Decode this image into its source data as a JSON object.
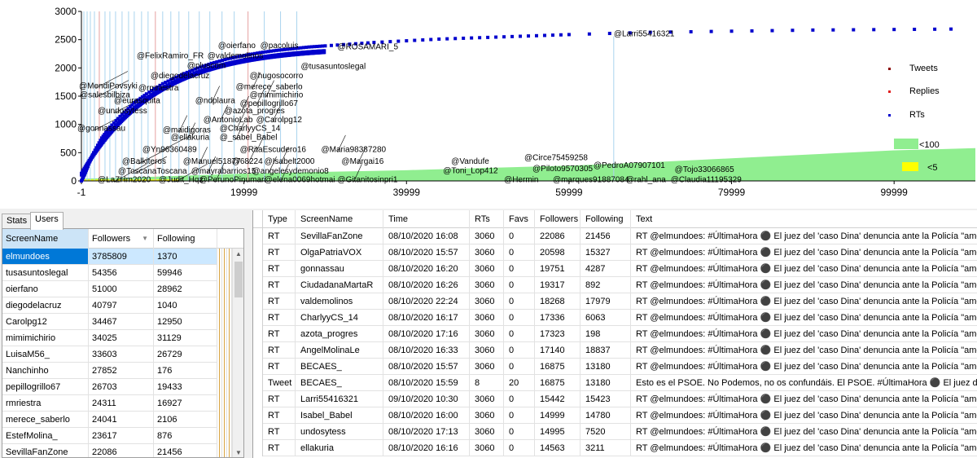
{
  "chart_data": {
    "type": "scatter",
    "title": "",
    "xlabel": "",
    "ylabel": "",
    "xlim": [
      -1,
      109999
    ],
    "ylim": [
      0,
      3000
    ],
    "x_ticks": [
      "-1",
      "19999",
      "39999",
      "59999",
      "79999",
      "99999"
    ],
    "y_ticks": [
      "0",
      "500",
      "1000",
      "1500",
      "2000",
      "2500",
      "3000"
    ],
    "legend_position": "right",
    "legend": [
      {
        "label": "Tweets",
        "color": "#8b0000"
      },
      {
        "label": "Replies",
        "color": "#e02020"
      },
      {
        "label": "RTs",
        "color": "#0000cd"
      },
      {
        "label": "<100",
        "color": "#90ee90"
      },
      {
        "label": "<5",
        "color": "#ffff00"
      }
    ],
    "series": [
      {
        "name": "RTs",
        "color": "#0000cd",
        "x": [
          0,
          400,
          800,
          1500,
          2500,
          3500,
          5000,
          6500,
          8000,
          10000,
          12000,
          14000,
          16000,
          18000,
          20000,
          22000,
          24000,
          26000,
          28000,
          30000,
          33000,
          36000,
          40000,
          44000,
          48000,
          52000,
          56000,
          60000,
          65000,
          70000,
          75000,
          80000,
          85000,
          90000,
          95000,
          100000,
          105000,
          109000
        ],
        "y": [
          0,
          120,
          260,
          500,
          760,
          950,
          1180,
          1380,
          1540,
          1720,
          1860,
          1980,
          2080,
          2160,
          2220,
          2270,
          2310,
          2340,
          2370,
          2390,
          2420,
          2450,
          2480,
          2510,
          2530,
          2550,
          2570,
          2590,
          2610,
          2630,
          2640,
          2650,
          2660,
          2670,
          2675,
          2680,
          2685,
          2690
        ]
      }
    ],
    "annotations": [
      {
        "text": "@Larri55416321",
        "x": 65500,
        "y": 2560
      },
      {
        "text": "@oierfano",
        "x": 16800,
        "y": 2350
      },
      {
        "text": "@pacoluis",
        "x": 22000,
        "y": 2350
      },
      {
        "text": "@ROSAMARI_5",
        "x": 31500,
        "y": 2330
      },
      {
        "text": "@FelixRamiro_FR",
        "x": 6800,
        "y": 2170
      },
      {
        "text": "@valdemolinos",
        "x": 15500,
        "y": 2170
      },
      {
        "text": "@pluscom",
        "x": 13000,
        "y": 2000
      },
      {
        "text": "@tusasuntoslegal",
        "x": 27000,
        "y": 1980
      },
      {
        "text": "@diegodelacruz",
        "x": 8500,
        "y": 1820
      },
      {
        "text": "@hugosocorro",
        "x": 20700,
        "y": 1820
      },
      {
        "text": "@MendiPovsyki",
        "x": -300,
        "y": 1640
      },
      {
        "text": "@rmriestra",
        "x": 7000,
        "y": 1600
      },
      {
        "text": "@merece_saberlo",
        "x": 19000,
        "y": 1620
      },
      {
        "text": "@salesbilbiza",
        "x": -200,
        "y": 1480
      },
      {
        "text": "@mimimichirio",
        "x": 20700,
        "y": 1480
      },
      {
        "text": "@eurasquita",
        "x": 4000,
        "y": 1380
      },
      {
        "text": "@ndplaura",
        "x": 14000,
        "y": 1380
      },
      {
        "text": "@pepillogrillo67",
        "x": 19500,
        "y": 1330
      },
      {
        "text": "@undosytess",
        "x": 2000,
        "y": 1200
      },
      {
        "text": "@azota_progres",
        "x": 17600,
        "y": 1200
      },
      {
        "text": "@AntonioLab",
        "x": 15000,
        "y": 1040
      },
      {
        "text": "@Carolpg12",
        "x": 21500,
        "y": 1040
      },
      {
        "text": "@gonnassau",
        "x": -500,
        "y": 890
      },
      {
        "text": "@maidigoras",
        "x": 10000,
        "y": 860
      },
      {
        "text": "@CharlyyCS_14",
        "x": 17000,
        "y": 890
      },
      {
        "text": "@ellakuria",
        "x": 11000,
        "y": 730
      },
      {
        "text": "@_sabel_Babel",
        "x": 17000,
        "y": 730
      },
      {
        "text": "@Yn96360489",
        "x": 7500,
        "y": 510
      },
      {
        "text": "@RitaEscudero16",
        "x": 19500,
        "y": 510
      },
      {
        "text": "@Maria98387280",
        "x": 29500,
        "y": 510
      },
      {
        "text": "@Balkiteros",
        "x": 5000,
        "y": 300
      },
      {
        "text": "@Manuel51877",
        "x": 12500,
        "y": 300
      },
      {
        "text": "@68224",
        "x": 18500,
        "y": 300
      },
      {
        "text": "@Isabelt2000",
        "x": 22500,
        "y": 300
      },
      {
        "text": "@Margai16",
        "x": 32000,
        "y": 300
      },
      {
        "text": "@Vandufe",
        "x": 45500,
        "y": 300
      },
      {
        "text": "@Circe75459258",
        "x": 54500,
        "y": 370
      },
      {
        "text": "@PedroA07907101",
        "x": 63000,
        "y": 230
      },
      {
        "text": "@Tojo33066865",
        "x": 73000,
        "y": 160
      },
      {
        "text": "@Toni_Lop412",
        "x": 44500,
        "y": 140
      },
      {
        "text": "@Piloto9570305",
        "x": 55500,
        "y": 170
      },
      {
        "text": "@ToscanaToscana",
        "x": 4500,
        "y": 130
      },
      {
        "text": "@mayrabarrios15",
        "x": 13500,
        "y": 130
      },
      {
        "text": "@angelesydemonio8",
        "x": 21000,
        "y": 130
      },
      {
        "text": "@LaZHm2020",
        "x": 2000,
        "y": -20
      },
      {
        "text": "@Judit_Hqz",
        "x": 9500,
        "y": -20
      },
      {
        "text": "@PerunoPinumari",
        "x": 14500,
        "y": -20
      },
      {
        "text": "@elena0069hotmai",
        "x": 22500,
        "y": -20
      },
      {
        "text": "@Gitanitosinpri1",
        "x": 31500,
        "y": -20
      },
      {
        "text": "@Hermin",
        "x": 52000,
        "y": -20
      },
      {
        "text": "@marques91887084",
        "x": 58000,
        "y": -20
      },
      {
        "text": "@rahl_ana",
        "x": 67000,
        "y": -20
      },
      {
        "text": "@Claudia11195329",
        "x": 72500,
        "y": -20
      }
    ]
  },
  "tabs": [
    {
      "label": "Stats",
      "active": false
    },
    {
      "label": "Users",
      "active": true
    }
  ],
  "users_grid": {
    "columns": [
      "ScreenName",
      "Followers",
      "Following"
    ],
    "sort_column": "Followers",
    "rows": [
      {
        "screen_name": "elmundoes",
        "followers": "3785809",
        "following": "1370",
        "selected": true
      },
      {
        "screen_name": "tusasuntoslegal",
        "followers": "54356",
        "following": "59946"
      },
      {
        "screen_name": "oierfano",
        "followers": "51000",
        "following": "28962"
      },
      {
        "screen_name": "diegodelacruz",
        "followers": "40797",
        "following": "1040"
      },
      {
        "screen_name": "Carolpg12",
        "followers": "34467",
        "following": "12950"
      },
      {
        "screen_name": "mimimichirio",
        "followers": "34025",
        "following": "31129"
      },
      {
        "screen_name": "LuisaM56_",
        "followers": "33603",
        "following": "26729"
      },
      {
        "screen_name": "Nanchinho",
        "followers": "27852",
        "following": "176"
      },
      {
        "screen_name": "pepillogrillo67",
        "followers": "26703",
        "following": "19433"
      },
      {
        "screen_name": "rmriestra",
        "followers": "24311",
        "following": "16927"
      },
      {
        "screen_name": "merece_saberlo",
        "followers": "24041",
        "following": "2106"
      },
      {
        "screen_name": "EstefMolina_",
        "followers": "23617",
        "following": "876"
      },
      {
        "screen_name": "SevillaFanZone",
        "followers": "22086",
        "following": "21456"
      }
    ]
  },
  "tweets_grid": {
    "columns": [
      "Type",
      "ScreenName",
      "Time",
      "RTs",
      "Favs",
      "Followers",
      "Following",
      "Text"
    ],
    "rows": [
      {
        "type": "RT",
        "screen_name": "SevillaFanZone",
        "time": "08/10/2020 16:08",
        "rts": "3060",
        "favs": "0",
        "followers": "22086",
        "following": "21456",
        "text": "RT @elmundoes: #ÚltimaHora ⚫ El juez del 'caso Dina' denuncia ante la Policía \"amenazas de ..."
      },
      {
        "type": "RT",
        "screen_name": "OlgaPatriaVOX",
        "time": "08/10/2020 15:57",
        "rts": "3060",
        "favs": "0",
        "followers": "20598",
        "following": "15327",
        "text": "RT @elmundoes: #ÚltimaHora ⚫ El juez del 'caso Dina' denuncia ante la Policía \"amenazas de ..."
      },
      {
        "type": "RT",
        "screen_name": "gonnassau",
        "time": "08/10/2020 16:20",
        "rts": "3060",
        "favs": "0",
        "followers": "19751",
        "following": "4287",
        "text": "RT @elmundoes: #ÚltimaHora ⚫ El juez del 'caso Dina' denuncia ante la Policía \"amenazas de ..."
      },
      {
        "type": "RT",
        "screen_name": "CiudadanaMartaR",
        "time": "08/10/2020 16:26",
        "rts": "3060",
        "favs": "0",
        "followers": "19317",
        "following": "892",
        "text": "RT @elmundoes: #ÚltimaHora ⚫ El juez del 'caso Dina' denuncia ante la Policía \"amenazas de ..."
      },
      {
        "type": "RT",
        "screen_name": "valdemolinos",
        "time": "08/10/2020 22:24",
        "rts": "3060",
        "favs": "0",
        "followers": "18268",
        "following": "17979",
        "text": "RT @elmundoes: #ÚltimaHora ⚫ El juez del 'caso Dina' denuncia ante la Policía \"amenazas de ..."
      },
      {
        "type": "RT",
        "screen_name": "CharlyyCS_14",
        "time": "08/10/2020 16:17",
        "rts": "3060",
        "favs": "0",
        "followers": "17336",
        "following": "6063",
        "text": "RT @elmundoes: #ÚltimaHora ⚫ El juez del 'caso Dina' denuncia ante la Policía \"amenazas de ..."
      },
      {
        "type": "RT",
        "screen_name": "azota_progres",
        "time": "08/10/2020 17:16",
        "rts": "3060",
        "favs": "0",
        "followers": "17323",
        "following": "198",
        "text": "RT @elmundoes: #ÚltimaHora ⚫ El juez del 'caso Dina' denuncia ante la Policía \"amenazas de ..."
      },
      {
        "type": "RT",
        "screen_name": "AngelMolinaLe",
        "time": "08/10/2020 16:33",
        "rts": "3060",
        "favs": "0",
        "followers": "17140",
        "following": "18837",
        "text": "RT @elmundoes: #ÚltimaHora ⚫ El juez del 'caso Dina' denuncia ante la Policía \"amenazas de ..."
      },
      {
        "type": "RT",
        "screen_name": "BECAES_",
        "time": "08/10/2020 15:57",
        "rts": "3060",
        "favs": "0",
        "followers": "16875",
        "following": "13180",
        "text": "RT @elmundoes: #ÚltimaHora ⚫ El juez del 'caso Dina' denuncia ante la Policía \"amenazas de ..."
      },
      {
        "type": "Tweet",
        "screen_name": "BECAES_",
        "time": "08/10/2020 15:59",
        "rts": "8",
        "favs": "20",
        "followers": "16875",
        "following": "13180",
        "text": "Esto es el PSOE. No Podemos, no os confundáis. El PSOE. #ÚltimaHora ⚫ El juez del 'caso Din..."
      },
      {
        "type": "RT",
        "screen_name": "Larri55416321",
        "time": "09/10/2020 10:30",
        "rts": "3060",
        "favs": "0",
        "followers": "15442",
        "following": "15423",
        "text": "RT @elmundoes: #ÚltimaHora ⚫ El juez del 'caso Dina' denuncia ante la Policía \"amenazas de ..."
      },
      {
        "type": "RT",
        "screen_name": "Isabel_Babel",
        "time": "08/10/2020 16:00",
        "rts": "3060",
        "favs": "0",
        "followers": "14999",
        "following": "14780",
        "text": "RT @elmundoes: #ÚltimaHora ⚫ El juez del 'caso Dina' denuncia ante la Policía \"amenazas de ..."
      },
      {
        "type": "RT",
        "screen_name": "undosytess",
        "time": "08/10/2020 17:13",
        "rts": "3060",
        "favs": "0",
        "followers": "14995",
        "following": "7520",
        "text": "RT @elmundoes: #ÚltimaHora ⚫ El juez del 'caso Dina' denuncia ante la Policía \"amenazas de ..."
      },
      {
        "type": "RT",
        "screen_name": "ellakuria",
        "time": "08/10/2020 16:16",
        "rts": "3060",
        "favs": "0",
        "followers": "14563",
        "following": "3211",
        "text": "RT @elmundoes: #ÚltimaHora ⚫ El juez del 'caso Dina' denuncia ante la Policía \"amenazas de ..."
      }
    ]
  }
}
